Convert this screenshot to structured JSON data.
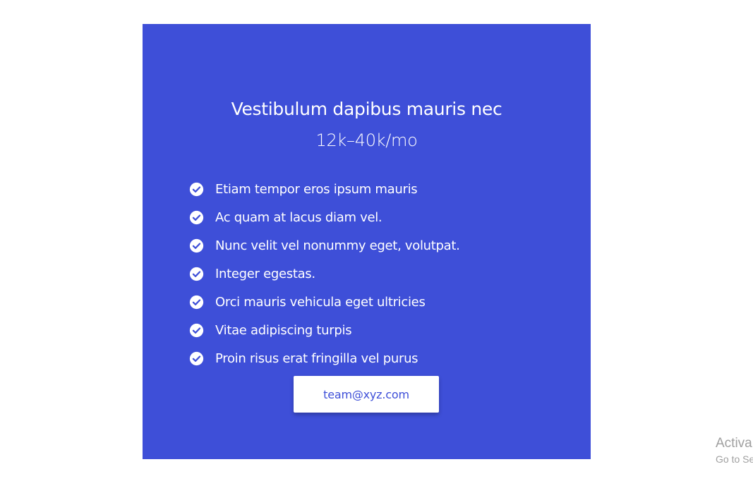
{
  "card": {
    "title": "Vestibulum dapibus mauris nec",
    "price": "12k–40k/mo",
    "features": [
      "Etiam tempor eros ipsum mauris",
      "Ac quam at lacus diam vel.",
      "Nunc velit vel nonummy eget, volutpat.",
      "Integer egestas.",
      "Orci mauris vehicula eget ultricies",
      "Vitae adipiscing turpis",
      "Proin risus erat fringilla vel purus"
    ],
    "feature_icon": "check-circle-icon",
    "button_label": "team@xyz.com"
  },
  "watermark": {
    "line1": "Activa",
    "line2": "Go to Se"
  },
  "colors": {
    "card_background": "#3e4fd8",
    "text_on_card": "#ffffff",
    "button_text": "#3e4fd8",
    "watermark_text": "#a0a0a0"
  }
}
